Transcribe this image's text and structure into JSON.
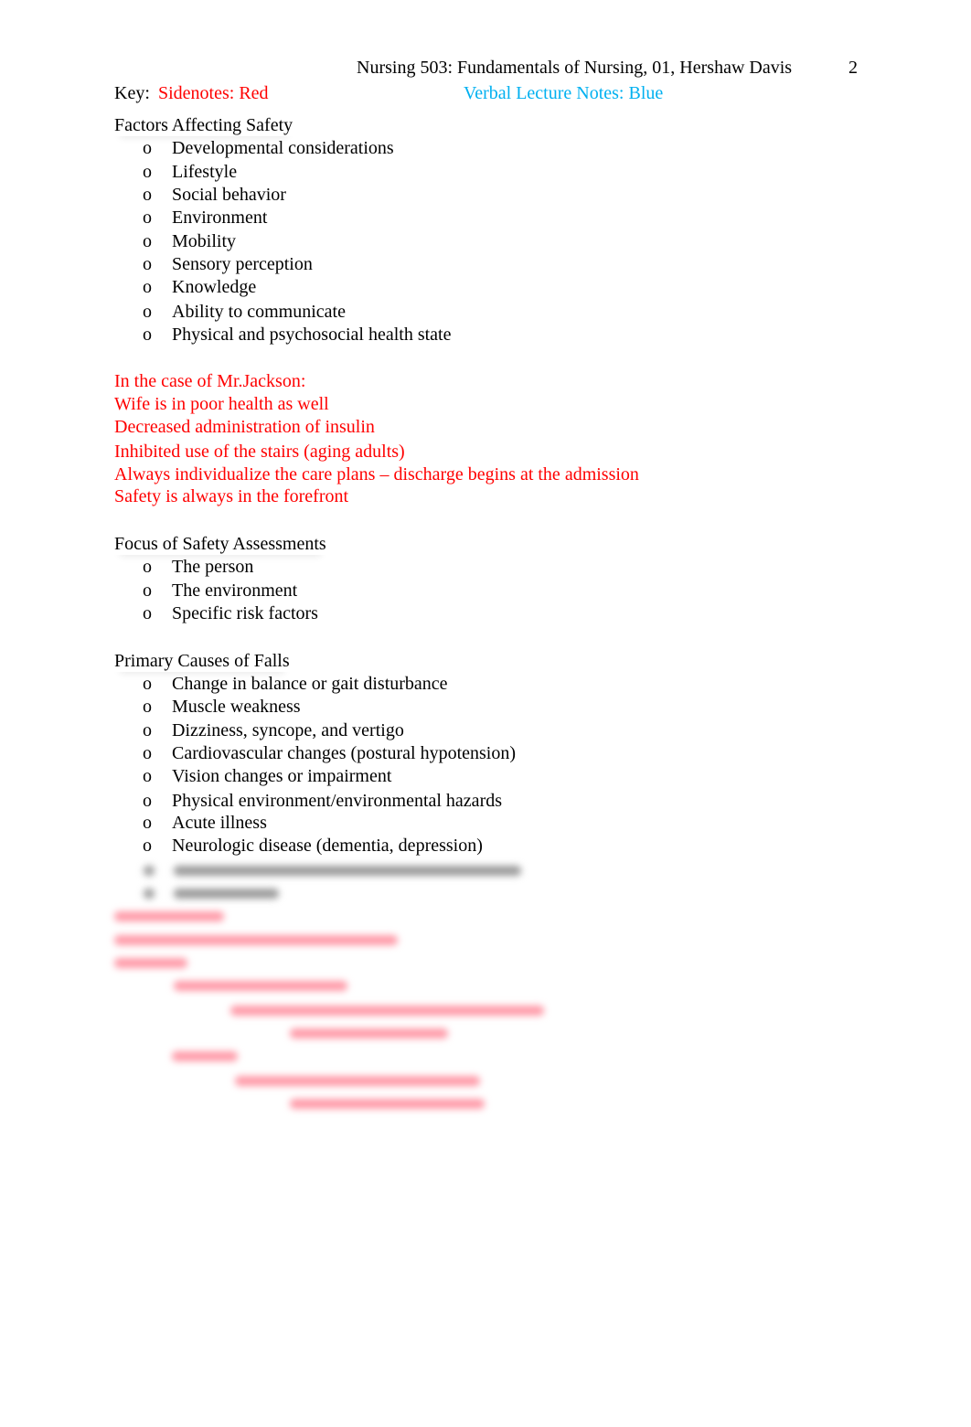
{
  "header": {
    "title": "Nursing 503: Fundamentals of Nursing, 01, Hershaw Davis",
    "page_number": "2"
  },
  "key": {
    "label": "Key:",
    "sidenotes": "Sidenotes: Red",
    "verbal": "Verbal Lecture Notes: Blue"
  },
  "colors": {
    "sidenotes": "#ff0000",
    "verbal": "#00b0f0"
  },
  "bullet_glyph": "o",
  "section1": {
    "heading": "Factors Affecting Safety",
    "items": [
      "Developmental considerations",
      "Lifestyle",
      "Social behavior",
      "Environment",
      "Mobility",
      "Sensory perception",
      "Knowledge",
      "Ability to communicate",
      "Physical and psychosocial health state"
    ]
  },
  "sidenotes1": [
    "In the case of Mr.Jackson:",
    "Wife is in poor health as well",
    "Decreased administration of insulin",
    "Inhibited use of the stairs (aging adults)",
    "Always individualize the care plans – discharge begins at the admission",
    "Safety is always in the forefront"
  ],
  "section2": {
    "heading": "Focus of Safety Assessments",
    "items": [
      "The person",
      "The environment",
      "Specific risk factors"
    ]
  },
  "section3": {
    "heading": "Primary Causes of Falls",
    "items": [
      "Change in balance or gait disturbance",
      "Muscle weakness",
      "Dizziness, syncope, and vertigo",
      "Cardiovascular changes (postural hypotension)",
      "Vision changes or impairment",
      "Physical environment/environmental hazards",
      "Acute illness",
      "Neurologic disease (dementia, depression)"
    ]
  }
}
